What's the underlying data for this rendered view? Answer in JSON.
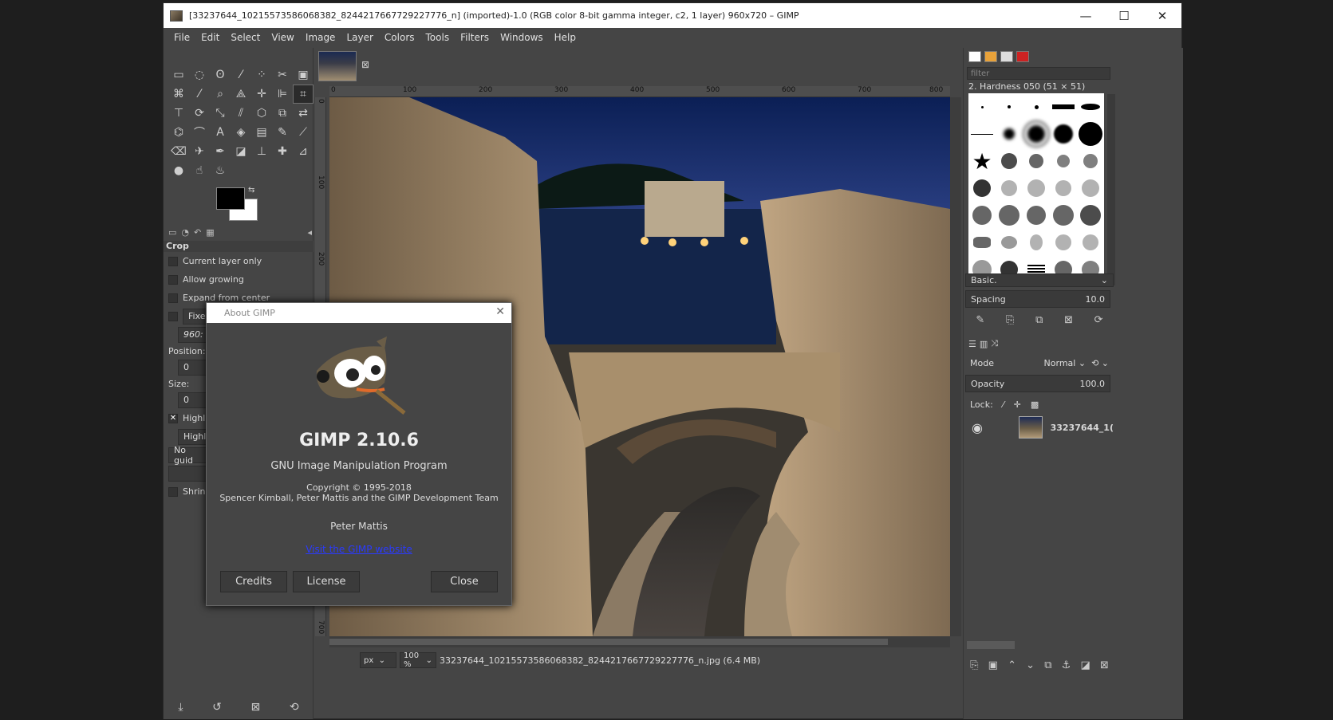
{
  "window": {
    "title": "[33237644_10215573586068382_8244217667729227776_n] (imported)-1.0 (RGB color 8-bit gamma integer, c2, 1 layer) 960x720 – GIMP",
    "minimize": "—",
    "maximize": "☐",
    "close": "✕"
  },
  "menu": [
    "File",
    "Edit",
    "Select",
    "View",
    "Image",
    "Layer",
    "Colors",
    "Tools",
    "Filters",
    "Windows",
    "Help"
  ],
  "tool_options": {
    "title": "Crop",
    "current_layer_only": "Current layer only",
    "allow_growing": "Allow growing",
    "expand_from_center": "Expand from center",
    "fixed": "Fixe",
    "fixed_value": "960:",
    "position_label": "Position:",
    "position_value": "0",
    "size_label": "Size:",
    "size_value": "0",
    "highlight": "Highli",
    "highlight_field": "Highli",
    "guides": "No guid",
    "shrink": "Shrinl"
  },
  "ruler": {
    "h": [
      "0",
      "100",
      "200",
      "300",
      "400",
      "500",
      "600",
      "700",
      "800"
    ],
    "v": [
      "0",
      "100",
      "200",
      "300",
      "700"
    ]
  },
  "status": {
    "unit": "px",
    "zoom": "100 %",
    "filename": "33237644_10215573586068382_8244217667729227776_n.jpg (6.4 MB)"
  },
  "brushes": {
    "filter_placeholder": "filter",
    "selected": "2. Hardness 050 (51 × 51)",
    "preset": "Basic.",
    "spacing_label": "Spacing",
    "spacing_value": "10.0"
  },
  "layers": {
    "mode_label": "Mode",
    "mode_value": "Normal",
    "opacity_label": "Opacity",
    "opacity_value": "100.0",
    "lock_label": "Lock:",
    "layer_name": "33237644_1("
  },
  "about": {
    "title": "About GIMP",
    "name": "GIMP 2.10.6",
    "subtitle": "GNU Image Manipulation Program",
    "copyright": "Copyright © 1995-2018",
    "team": "Spencer Kimball, Peter Mattis and the GIMP Development Team",
    "author": "Peter Mattis",
    "link": "Visit the GIMP website",
    "credits": "Credits",
    "license": "License",
    "close": "Close"
  }
}
